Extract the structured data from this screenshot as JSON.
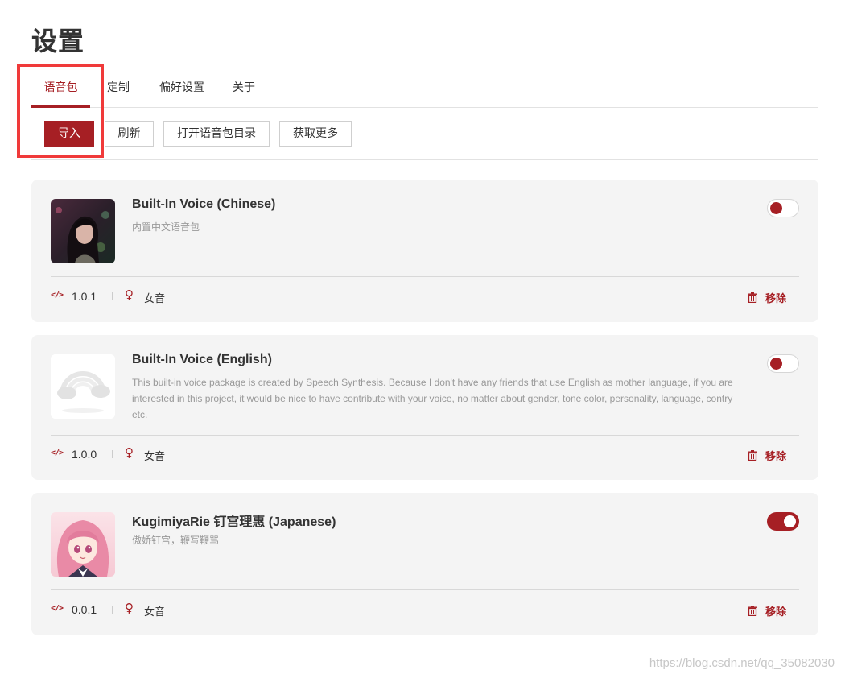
{
  "page": {
    "title": "设置"
  },
  "tabs": [
    {
      "label": "语音包",
      "active": true
    },
    {
      "label": "定制",
      "active": false
    },
    {
      "label": "偏好设置",
      "active": false
    },
    {
      "label": "关于",
      "active": false
    }
  ],
  "toolbar": {
    "import_label": "导入",
    "refresh_label": "刷新",
    "open_dir_label": "打开语音包目录",
    "get_more_label": "获取更多"
  },
  "voice_packs": [
    {
      "title": "Built-In Voice (Chinese)",
      "description": "内置中文语音包",
      "version": "1.0.1",
      "gender": "女音",
      "enabled": false,
      "remove_label": "移除"
    },
    {
      "title": "Built-In Voice (English)",
      "description": "This built-in voice package is created by Speech Synthesis. Because I don't have any friends that use English as mother language, if you are interested in this project, it would be nice to have contribute with your voice, no matter about gender, tone color, personality, language, contry etc.",
      "version": "1.0.0",
      "gender": "女音",
      "enabled": false,
      "remove_label": "移除"
    },
    {
      "title": "KugimiyaRie 钉宫理惠 (Japanese)",
      "description": "傲娇钉宫，鞭写鞭骂",
      "version": "0.0.1",
      "gender": "女音",
      "enabled": true,
      "remove_label": "移除"
    }
  ],
  "colors": {
    "accent": "#a61f24",
    "card_bg": "#f4f4f4",
    "highlight": "#f03a3a"
  },
  "watermark": "https://blog.csdn.net/qq_35082030"
}
